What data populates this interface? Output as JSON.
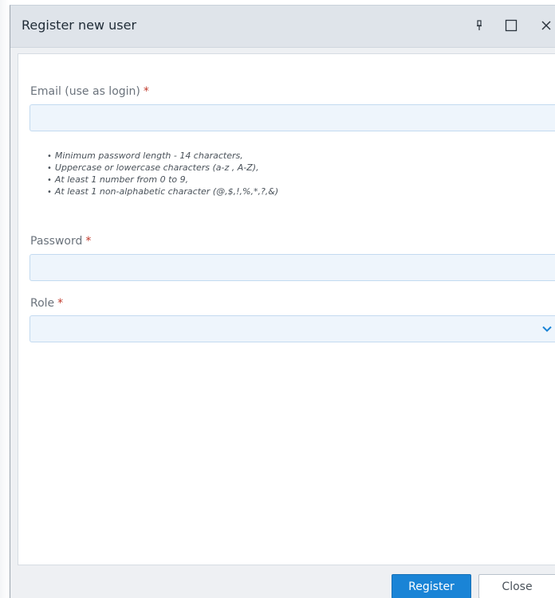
{
  "dialog": {
    "title": "Register new user",
    "controls": {
      "pin_icon": "pin-icon",
      "maximize_icon": "maximize-icon",
      "close_icon": "close-icon"
    }
  },
  "form": {
    "email": {
      "label": "Email (use as login)",
      "required_mark": "*",
      "value": "",
      "placeholder": ""
    },
    "password_rules": [
      "Minimum password length - 14 characters,",
      "Uppercase or lowercase characters (a-z , A-Z),",
      "At least 1 number from 0 to 9,",
      "At least 1 non-alphabetic character (@,$,!,%,*,?,&)"
    ],
    "password": {
      "label": "Password",
      "required_mark": "*",
      "value": "",
      "placeholder": ""
    },
    "role": {
      "label": "Role",
      "required_mark": "*",
      "selected": ""
    }
  },
  "footer": {
    "register_label": "Register",
    "close_label": "Close"
  },
  "colors": {
    "accent": "#1a84d6",
    "required": "#c0392b",
    "input_bg": "#eef5fc",
    "input_border": "#c3daf0",
    "titlebar_bg": "#dfe4ea"
  }
}
